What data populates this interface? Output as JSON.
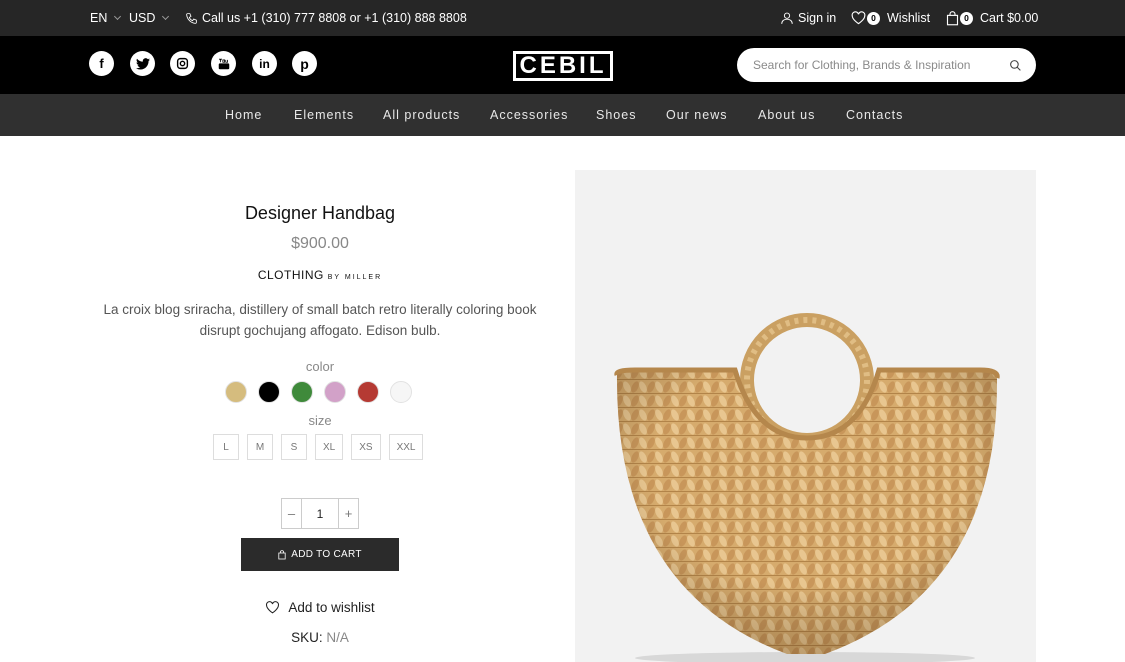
{
  "topbar": {
    "language": "EN",
    "currency": "USD",
    "phone": "Call us +1 (310) 777 8808 or +1 (310) 888 8808",
    "sign_in": "Sign in",
    "wishlist_count": "0",
    "wishlist_label": "Wishlist",
    "cart_count": "0",
    "cart_label": "Cart $0.00"
  },
  "header": {
    "logo_text": "CEBIL",
    "social_icons": [
      "facebook-icon",
      "twitter-icon",
      "instagram-icon",
      "youtube-icon",
      "linkedin-icon",
      "pinterest-icon"
    ],
    "search_placeholder": "Search for Clothing, Brands & Inspiration"
  },
  "nav": {
    "items": [
      "Home",
      "Elements",
      "All products",
      "Accessories",
      "Shoes",
      "Our news",
      "About us",
      "Contacts"
    ]
  },
  "product": {
    "title": "Designer Handbag",
    "price": "$900.00",
    "brand_main": "CLOTHING",
    "brand_sub": "BY MILLER",
    "description": "La croix blog sriracha, distillery of small batch retro literally coloring book disrupt gochujang affogato. Edison bulb.",
    "color_label": "color",
    "colors": [
      "#d5bc7e",
      "#000000",
      "#3f8a3b",
      "#d2a1c8",
      "#b53a33",
      "#f6f6f6"
    ],
    "size_label": "size",
    "sizes": [
      "L",
      "M",
      "S",
      "XL",
      "XS",
      "XXL"
    ],
    "quantity": "1",
    "add_to_cart": "ADD TO CART",
    "add_to_wishlist": "Add to wishlist",
    "sku_label": "SKU:",
    "sku_value": "N/A"
  },
  "colors": {
    "topbar_bg": "#262626",
    "header_bg": "#000000",
    "nav_bg": "#303030",
    "button_bg": "#2b2b2b",
    "image_bg": "#f2f2f2"
  }
}
